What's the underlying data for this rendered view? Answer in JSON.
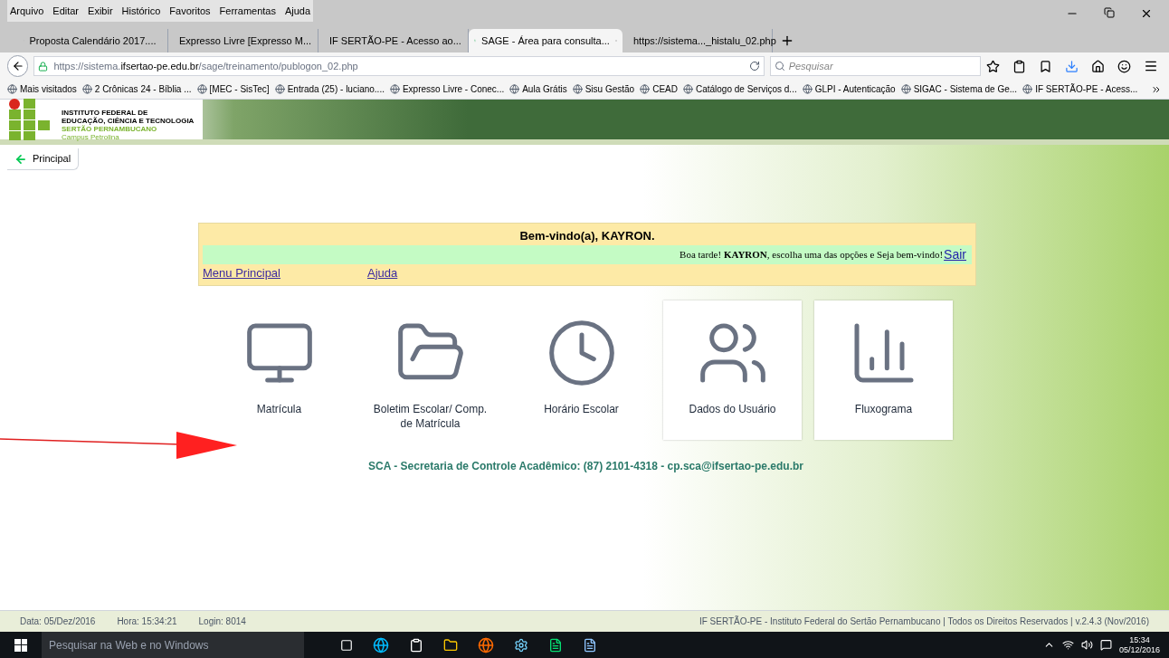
{
  "menu_bar": [
    "Arquivo",
    "Editar",
    "Exibir",
    "Histórico",
    "Favoritos",
    "Ferramentas",
    "Ajuda"
  ],
  "tabs": [
    {
      "label": "Proposta Calendário 2017....",
      "selected": false
    },
    {
      "label": "Expresso Livre [Expresso M...",
      "selected": false
    },
    {
      "label": "IF SERTÃO-PE - Acesso ao...",
      "selected": false
    },
    {
      "label": "SAGE - Área para consulta...",
      "selected": true
    },
    {
      "label": "https://sistema..._histalu_02.php",
      "selected": false
    }
  ],
  "address": {
    "prefix": "https://sistema.",
    "domain": "ifsertao-pe.edu.br",
    "path": "/sage/treinamento/publogon_02.php"
  },
  "search": {
    "placeholder": "Pesquisar"
  },
  "bookmarks": [
    "Mais visitados",
    "2 Crônicas 24 - Bíblia ...",
    "[MEC - SisTec]",
    "Entrada (25) - luciano....",
    "Expresso Livre - Conec...",
    "Aula Grátis",
    "Sisu Gestão",
    "CEAD",
    "Catálogo de Serviços d...",
    "GLPI - Autenticação",
    "SIGAC - Sistema de Ge...",
    "IF SERTÃO-PE - Acess..."
  ],
  "logo": {
    "line_1": "INSTITUTO FEDERAL DE",
    "line_2": "EDUCAÇÃO, CIÊNCIA E TECNOLOGIA",
    "line_3": "SERTÃO PERNAMBUCANO",
    "line_4": "Campus Petrolina"
  },
  "back_link": "Principal",
  "welcome": {
    "title": "Bem-vindo(a), KAYRON.",
    "greeting": "Boa tarde! **KAYRON**, escolha uma das opções e Seja bem-vindo!",
    "logout": "Sair",
    "links": [
      "Menu Principal",
      "Ajuda"
    ]
  },
  "tiles": [
    {
      "kind": "computer",
      "label": "Matrícula",
      "highlighted": false
    },
    {
      "kind": "folder",
      "label": "Boletim Escolar/ Comp. de Matrícula",
      "highlighted": false
    },
    {
      "kind": "clock",
      "label": "Horário Escolar",
      "highlighted": false
    },
    {
      "kind": "users",
      "label": "Dados do Usuário",
      "highlighted": true
    },
    {
      "kind": "chart",
      "label": "Fluxograma",
      "highlighted": true
    }
  ],
  "contact": "SCA - Secretaria de Controle Acadêmico: (87) 2101-4318 - cp.sca@ifsertao-pe.edu.br",
  "footer": {
    "date": "Data: 05/Dez/2016",
    "time": "Hora: 15:34:21",
    "login": "Login: 8014",
    "copyright": "IF SERTÃO-PE - Instituto Federal do Sertão Pernambucano | Todos os Direitos Reservados | v.2.4.3 (Nov/2016)"
  },
  "taskbar": {
    "search_placeholder": "Pesquisar na Web e no Windows",
    "clock": "15:34",
    "date": "05/12/2016"
  }
}
